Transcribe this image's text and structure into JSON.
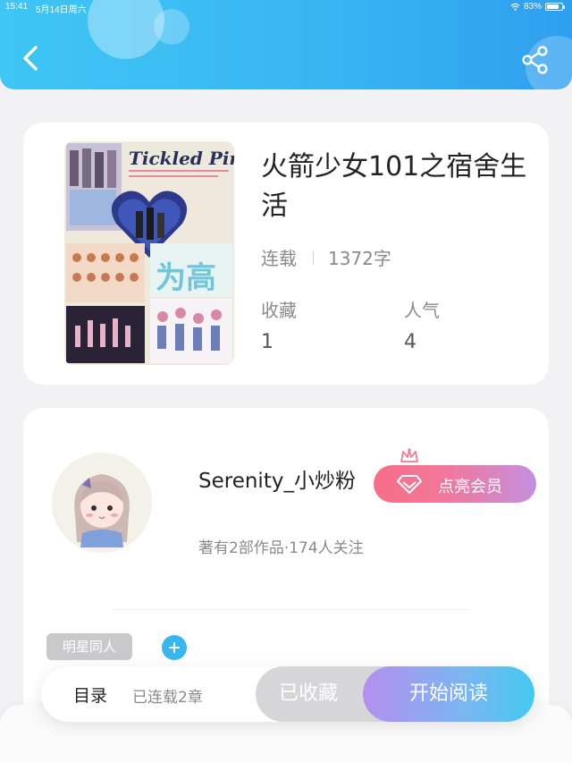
{
  "status_bar": {
    "time": "15:41",
    "date": "5月14日周六",
    "battery": "83%",
    "battery_level": 0.83
  },
  "header": {
    "back_icon": "chevron-left-icon",
    "share_icon": "share-icon",
    "background_color": "#3cbaf2"
  },
  "book": {
    "title": "火箭少女101之宿舍生活",
    "status": "连载",
    "word_count": "1372字",
    "cover_text": "Tickled Pink",
    "stats": {
      "favorites_label": "收藏",
      "favorites_value": "1",
      "popularity_label": "人气",
      "popularity_value": "4"
    }
  },
  "author": {
    "name": "Serenity_小炒粉",
    "vip_label": "点亮会员",
    "stats_text": "著有2部作品·174人关注",
    "tag": "明星同人"
  },
  "bottom_bar": {
    "toc_label": "目录",
    "chapter_count": "已连载2章",
    "collected_label": "已收藏",
    "read_label": "开始阅读",
    "accent_color": "#44c9f0"
  }
}
